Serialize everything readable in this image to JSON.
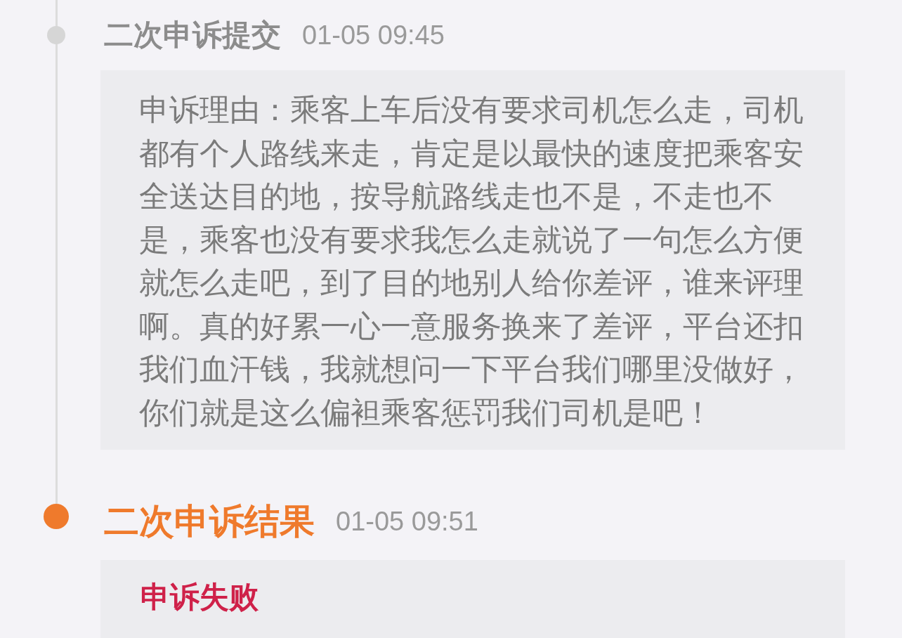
{
  "timeline": [
    {
      "title": "二次申诉提交",
      "time": "01-05 09:45",
      "active": false,
      "detail": {
        "kind": "paragraph",
        "text": "申诉理由：乘客上车后没有要求司机怎么走，司机都有个人路线来走，肯定是以最快的速度把乘客安全送达目的地，按导航路线走也不是，不走也不是，乘客也没有要求我怎么走就说了一句怎么方便就怎么走吧，到了目的地别人给你差评，谁来评理啊。真的好累一心一意服务换来了差评，平台还扣我们血汗钱，我就想问一下平台我们哪里没做好，你们就是这么偏袒乘客惩罚我们司机是吧！"
      }
    },
    {
      "title": "二次申诉结果",
      "time": "01-05 09:51",
      "active": true,
      "detail": {
        "kind": "result",
        "text": "申诉失败"
      }
    }
  ]
}
